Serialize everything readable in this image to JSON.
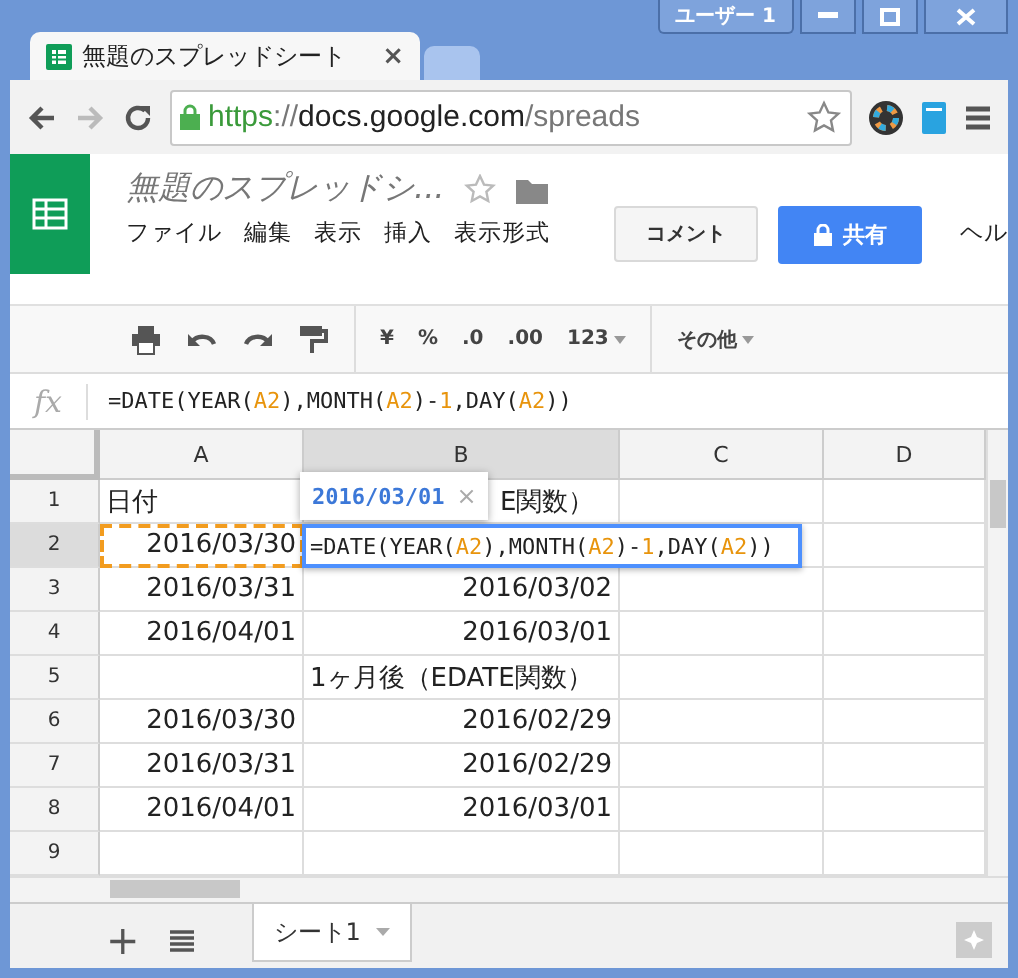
{
  "window": {
    "user_button": "ユーザー 1"
  },
  "tabs": [
    {
      "title": "無題のスプレッドシート",
      "close": "×",
      "selected": true
    },
    {
      "selected": false
    }
  ],
  "address_bar": {
    "url": [
      {
        "text": "https",
        "kind": "scheme"
      },
      {
        "text": "://",
        "kind": "dim"
      },
      {
        "text": "docs.google.com",
        "kind": "host"
      },
      {
        "text": "/spreads",
        "kind": "dim"
      }
    ]
  },
  "navigation": {
    "forward_disabled": true
  },
  "document": {
    "title": "無題のスプレッドシ...",
    "starred": false
  },
  "menu": [
    "ファイル",
    "編集",
    "表示",
    "挿入",
    "表示形式",
    "ヘル"
  ],
  "header_buttons": {
    "comment": "コメント",
    "share": "共有"
  },
  "toolbar": {
    "currency": "¥",
    "percent": "%",
    "decrease_decimals": ".0",
    "increase_decimals": ".00",
    "number_format": "123",
    "more": "その他"
  },
  "formula_bar": {
    "label": "fx",
    "tokens": [
      {
        "text": "=DATE(YEAR(",
        "kind": "plain"
      },
      {
        "text": "A2",
        "kind": "ref"
      },
      {
        "text": "),MONTH(",
        "kind": "plain"
      },
      {
        "text": "A2",
        "kind": "ref"
      },
      {
        "text": ")-",
        "kind": "plain"
      },
      {
        "text": "1",
        "kind": "ref"
      },
      {
        "text": ",DAY(",
        "kind": "plain"
      },
      {
        "text": "A2",
        "kind": "ref"
      },
      {
        "text": "))",
        "kind": "plain"
      }
    ]
  },
  "columns": [
    {
      "label": "A",
      "selected": false
    },
    {
      "label": "B",
      "selected": true
    },
    {
      "label": "C",
      "selected": false
    },
    {
      "label": "D",
      "selected": false
    }
  ],
  "rows": [
    {
      "number": "1",
      "selected": false,
      "a": {
        "text": "日付",
        "kind": "text"
      },
      "b": {
        "text": "E関数）",
        "kind": "covered"
      }
    },
    {
      "number": "2",
      "selected": true,
      "a": {
        "text": "2016/03/30",
        "kind": "date",
        "copied": true
      }
    },
    {
      "number": "3",
      "selected": false,
      "a": {
        "text": "2016/03/31",
        "kind": "date"
      },
      "b": {
        "text": "2016/03/02",
        "kind": "date"
      }
    },
    {
      "number": "4",
      "selected": false,
      "a": {
        "text": "2016/04/01",
        "kind": "date"
      },
      "b": {
        "text": "2016/03/01",
        "kind": "date"
      }
    },
    {
      "number": "5",
      "selected": false,
      "b": {
        "text": "1ヶ月後（EDATE関数）",
        "kind": "text"
      }
    },
    {
      "number": "6",
      "selected": false,
      "a": {
        "text": "2016/03/30",
        "kind": "date"
      },
      "b": {
        "text": "2016/02/29",
        "kind": "date"
      }
    },
    {
      "number": "7",
      "selected": false,
      "a": {
        "text": "2016/03/31",
        "kind": "date"
      },
      "b": {
        "text": "2016/02/29",
        "kind": "date"
      }
    },
    {
      "number": "8",
      "selected": false,
      "a": {
        "text": "2016/04/01",
        "kind": "date"
      },
      "b": {
        "text": "2016/03/01",
        "kind": "date"
      }
    },
    {
      "number": "9",
      "selected": false
    }
  ],
  "formula_preview": {
    "value": "2016/03/01",
    "close": "×"
  },
  "cell_editor": {
    "tokens": [
      {
        "text": "=DATE(YEAR(",
        "kind": "plain"
      },
      {
        "text": "A2",
        "kind": "ref"
      },
      {
        "text": "),MONTH(",
        "kind": "plain"
      },
      {
        "text": "A2",
        "kind": "ref"
      },
      {
        "text": ")-",
        "kind": "plain"
      },
      {
        "text": "1",
        "kind": "ref"
      },
      {
        "text": ",DAY(",
        "kind": "plain"
      },
      {
        "text": "A2",
        "kind": "ref"
      },
      {
        "text": "))",
        "kind": "plain"
      }
    ]
  },
  "sheet_tabs": [
    {
      "label": "シート1",
      "selected": true
    }
  ],
  "add_sheet": "+"
}
